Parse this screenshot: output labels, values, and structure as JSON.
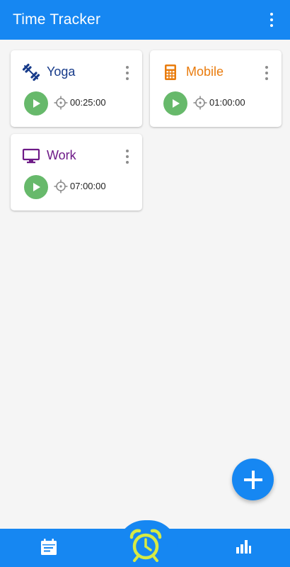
{
  "app": {
    "title": "Time Tracker"
  },
  "colors": {
    "primary": "#1687f2",
    "play": "#67b96b",
    "yoga": "#173b8a",
    "mobile": "#e97c0e",
    "work": "#6e1a87",
    "alarm": "#d6ea45"
  },
  "activities": [
    {
      "name": "Yoga",
      "time": "00:25:00",
      "icon": "dumbbell-icon",
      "color": "#173b8a"
    },
    {
      "name": "Mobile",
      "time": "01:00:00",
      "icon": "calculator-icon",
      "color": "#e97c0e"
    },
    {
      "name": "Work",
      "time": "07:00:00",
      "icon": "monitor-icon",
      "color": "#6e1a87"
    }
  ],
  "bottom_nav": [
    {
      "icon": "calendar-icon"
    },
    {
      "icon": "alarm-clock-icon",
      "active": true
    },
    {
      "icon": "bar-chart-icon"
    }
  ]
}
